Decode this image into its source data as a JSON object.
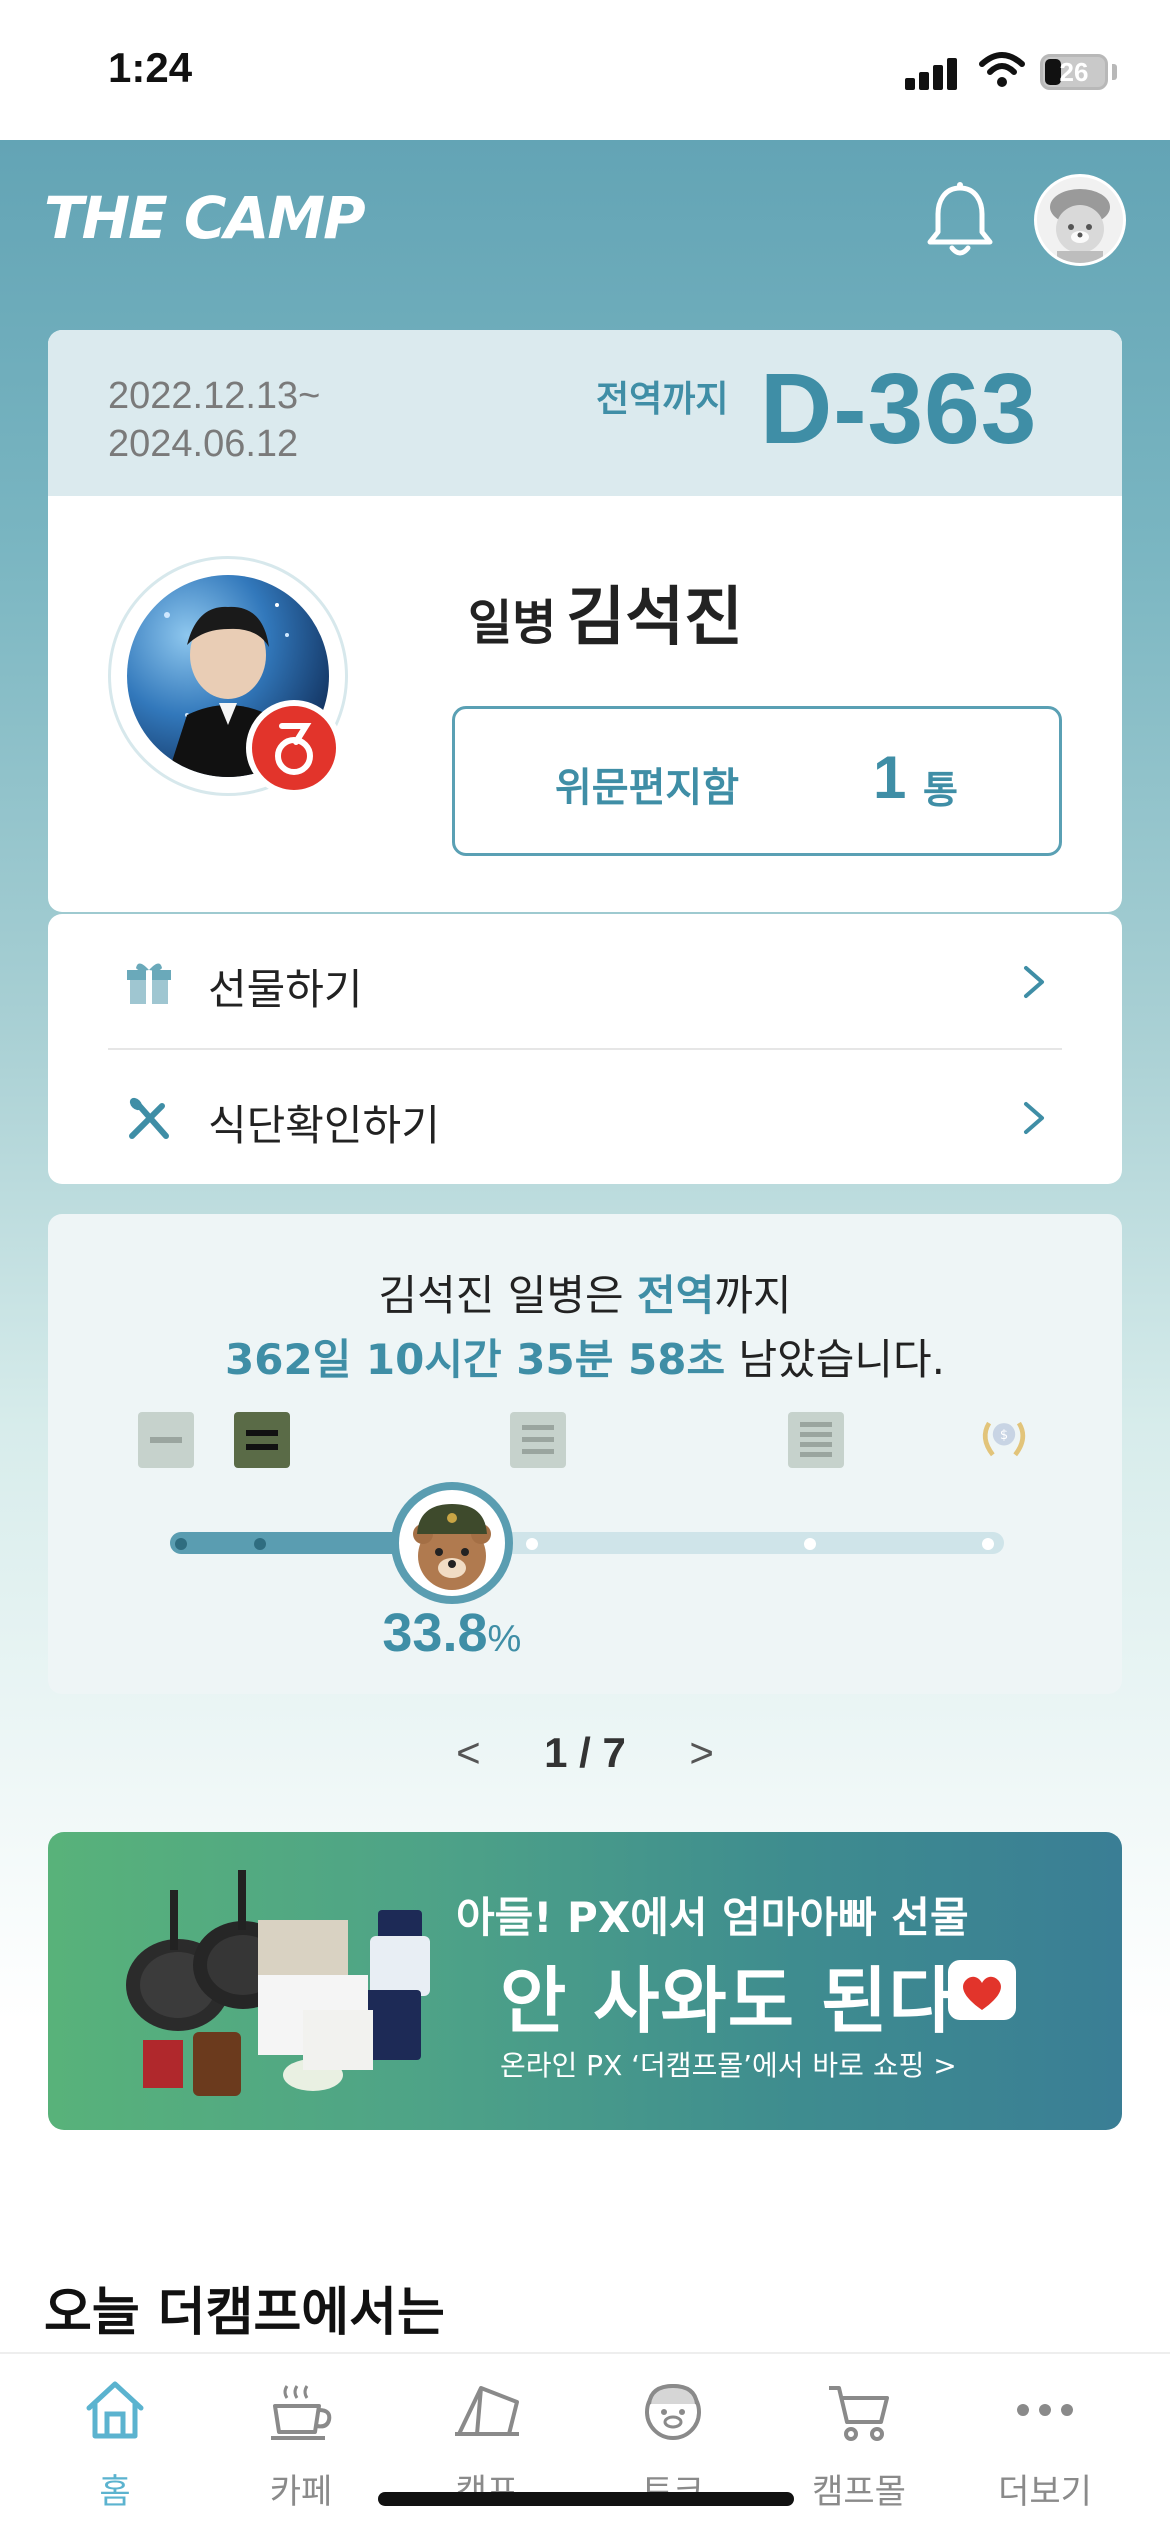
{
  "status_bar": {
    "time": "1:24",
    "battery": "26"
  },
  "header": {
    "logo": "THE CAMP"
  },
  "service": {
    "start_date": "2022.12.13~",
    "end_date": "2024.06.12",
    "dday_label": "전역까지",
    "dday_value": "D-363",
    "rank": "일병",
    "name": "김석진",
    "letters_label": "위문편지함",
    "letters_count": "1",
    "letters_unit": "통"
  },
  "menu": [
    {
      "label": "선물하기",
      "icon": "gift-icon"
    },
    {
      "label": "식단확인하기",
      "icon": "utensils-icon"
    }
  ],
  "progress": {
    "line1_pre": "김석진 일병은 ",
    "line1_hl": "전역",
    "line1_post": "까지",
    "line2_hl": "362일 10시간 35분 58초",
    "line2_post": " 남았습니다.",
    "percent": "33.8",
    "percent_unit": "%",
    "fraction": 0.338
  },
  "pager": {
    "prev": "<",
    "text": "1 / 7",
    "next": ">"
  },
  "banner": {
    "line1": "아들! PX에서 엄마아빠 선물",
    "line2": "안 사와도 된다",
    "line3": "온라인 PX ‘더캠프몰’에서 바로 쇼핑 >"
  },
  "section": {
    "title": "오늘 더캠프에서는"
  },
  "tabs": [
    {
      "label": "홈",
      "icon": "home-icon",
      "active": true
    },
    {
      "label": "카페",
      "icon": "coffee-cup-icon",
      "active": false
    },
    {
      "label": "캠프",
      "icon": "tent-icon",
      "active": false
    },
    {
      "label": "토크",
      "icon": "bear-face-icon",
      "active": false
    },
    {
      "label": "캠프몰",
      "icon": "cart-icon",
      "active": false
    },
    {
      "label": "더보기",
      "icon": "more-dots-icon",
      "active": false
    }
  ],
  "colors": {
    "accent": "#3f8ea6",
    "tab_active": "#5bb3cf",
    "header_bg": "#63a4b5"
  }
}
